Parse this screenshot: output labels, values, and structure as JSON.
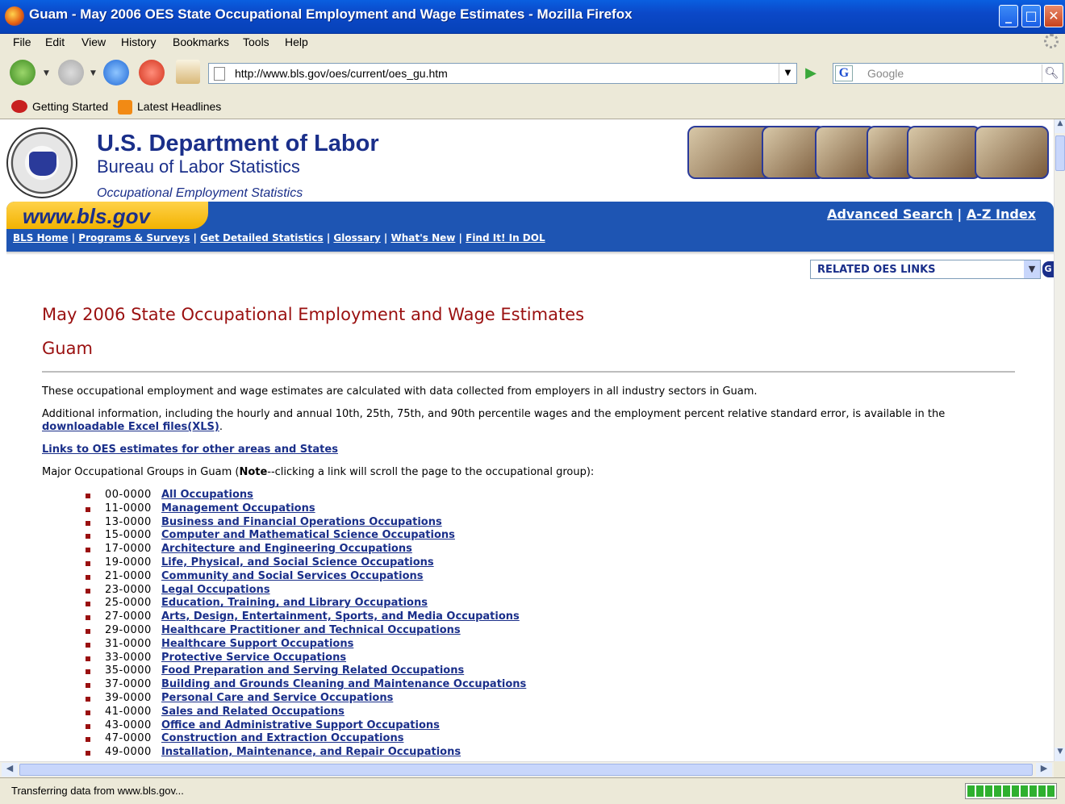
{
  "window": {
    "title": "Guam - May 2006 OES State Occupational Employment and Wage Estimates - Mozilla Firefox",
    "buttons": {
      "minimize": "_",
      "maximize": "□",
      "close": "✕"
    }
  },
  "menu": [
    "File",
    "Edit",
    "View",
    "History",
    "Bookmarks",
    "Tools",
    "Help"
  ],
  "navbar": {
    "url": "http://www.bls.gov/oes/current/oes_gu.htm",
    "search_placeholder": "Google"
  },
  "bookmarks": [
    "Getting Started",
    "Latest Headlines"
  ],
  "header": {
    "title": "U.S. Department of Labor",
    "subtitle": "Bureau of Labor Statistics",
    "program": "Occupational Employment Statistics",
    "www": "www.bls.gov",
    "advanced_search": "Advanced Search",
    "separator": "|",
    "az_index": "A-Z Index"
  },
  "nav_links": [
    "BLS Home",
    "Programs & Surveys",
    "Get Detailed Statistics",
    "Glossary",
    "What's New",
    "Find It! In DOL"
  ],
  "related_select": "RELATED OES LINKS",
  "related_go": "G",
  "main": {
    "heading": "May 2006 State Occupational Employment and Wage Estimates",
    "subheading": "Guam",
    "para1": "These occupational employment and wage estimates are calculated with data collected from employers in all industry sectors in Guam.",
    "para2_text": "Additional information, including the hourly and annual 10th, 25th, 75th, and 90th percentile wages and the employment percent relative standard error, is available in the ",
    "para2_link": "downloadable Excel files(XLS)",
    "para2_end": ".",
    "areas_link": "Links to OES estimates for other areas and States",
    "groups_intro_start": "Major Occupational Groups in Guam (",
    "groups_intro_bold": "Note",
    "groups_intro_end": "--clicking a link will scroll the page to the occupational group):",
    "groups": [
      {
        "code": "00-0000",
        "name": "All Occupations"
      },
      {
        "code": "11-0000",
        "name": "Management Occupations"
      },
      {
        "code": "13-0000",
        "name": "Business and Financial Operations Occupations"
      },
      {
        "code": "15-0000",
        "name": "Computer and Mathematical Science Occupations"
      },
      {
        "code": "17-0000",
        "name": "Architecture and Engineering Occupations"
      },
      {
        "code": "19-0000",
        "name": "Life, Physical, and Social Science Occupations"
      },
      {
        "code": "21-0000",
        "name": "Community and Social Services Occupations"
      },
      {
        "code": "23-0000",
        "name": "Legal Occupations"
      },
      {
        "code": "25-0000",
        "name": "Education, Training, and Library Occupations"
      },
      {
        "code": "27-0000",
        "name": "Arts, Design, Entertainment, Sports, and Media Occupations"
      },
      {
        "code": "29-0000",
        "name": "Healthcare Practitioner and Technical Occupations"
      },
      {
        "code": "31-0000",
        "name": "Healthcare Support Occupations"
      },
      {
        "code": "33-0000",
        "name": "Protective Service Occupations"
      },
      {
        "code": "35-0000",
        "name": "Food Preparation and Serving Related Occupations"
      },
      {
        "code": "37-0000",
        "name": "Building and Grounds Cleaning and Maintenance Occupations"
      },
      {
        "code": "39-0000",
        "name": "Personal Care and Service Occupations"
      },
      {
        "code": "41-0000",
        "name": "Sales and Related Occupations"
      },
      {
        "code": "43-0000",
        "name": "Office and Administrative Support Occupations"
      },
      {
        "code": "47-0000",
        "name": "Construction and Extraction Occupations"
      },
      {
        "code": "49-0000",
        "name": "Installation, Maintenance, and Repair Occupations"
      }
    ]
  },
  "status": {
    "text": "Transferring data from www.bls.gov...",
    "progress": 1.0
  }
}
